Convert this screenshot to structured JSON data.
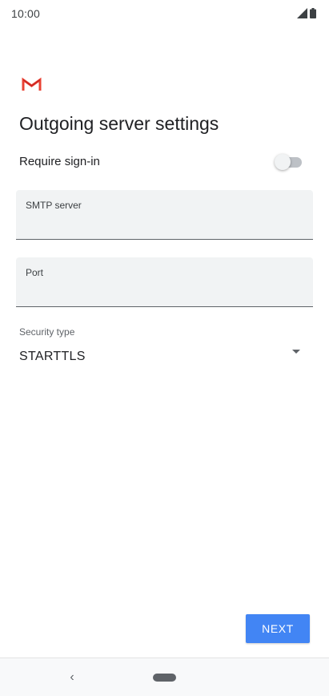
{
  "status_bar": {
    "time": "10:00",
    "icons": [
      "signal-icon",
      "battery-icon"
    ]
  },
  "app": {
    "logo": "gmail-logo-icon",
    "brand_color": "#EA4335"
  },
  "page": {
    "title": "Outgoing server settings"
  },
  "require_signin": {
    "label": "Require sign-in",
    "enabled": false
  },
  "smtp_server": {
    "label": "SMTP server",
    "value": ""
  },
  "port": {
    "label": "Port",
    "value": ""
  },
  "security_type": {
    "label": "Security type",
    "value": "STARTTLS"
  },
  "actions": {
    "next_label": "NEXT",
    "accent": "#4285F4"
  },
  "nav": {
    "back_glyph": "‹"
  }
}
